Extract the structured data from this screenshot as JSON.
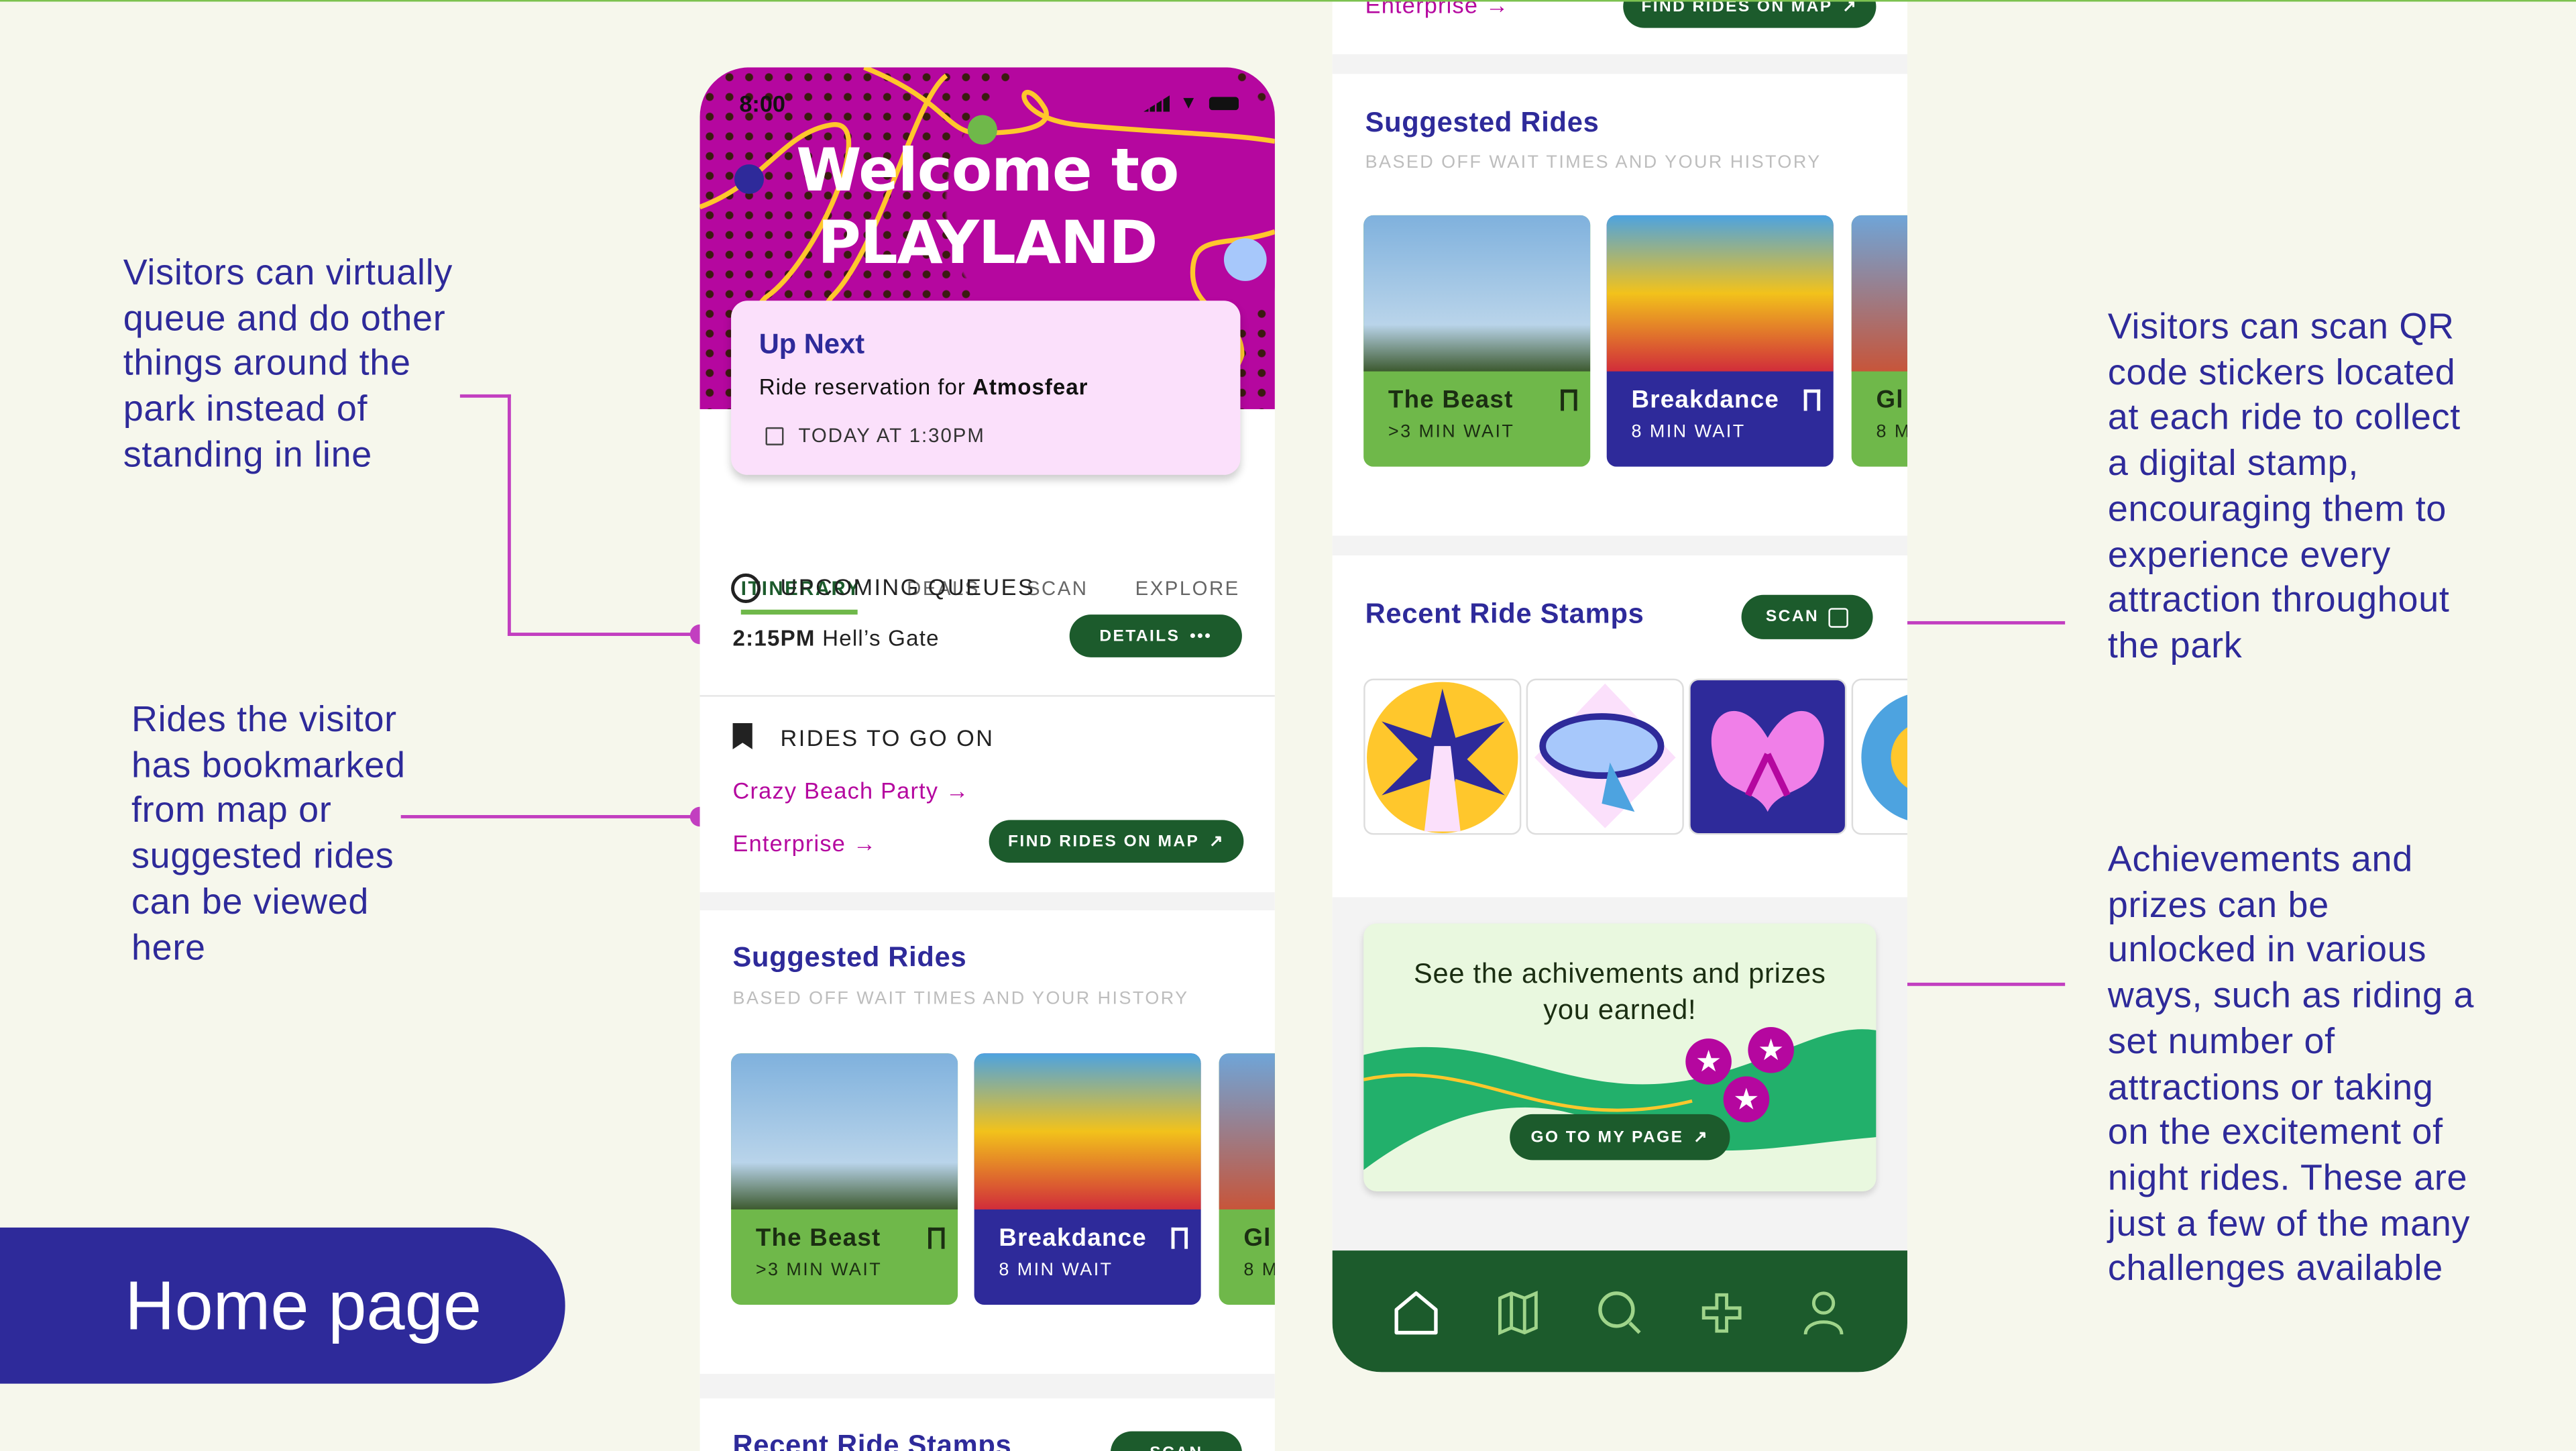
{
  "annotations": {
    "left_top": "Visitors can virtually queue and do other things around the park instead of standing in line",
    "left_bottom": "Rides the visitor has bookmarked from map or suggested rides can be viewed here",
    "right_top": "Visitors can scan QR code stickers located at each ride to collect a digital stamp, encouraging them to experience every attraction throughout the park",
    "right_bottom": "Achievements and prizes can be unlocked in various ways, such as riding a set number of attractions or taking on the excitement of night rides. These are just a few of the many challenges available"
  },
  "page_label": "Home page",
  "colors": {
    "indigo": "#2e2a9a",
    "magenta": "#b5079f",
    "dark_green": "#1c5b2c",
    "green": "#6fb84a",
    "pink": "#fbe0fb"
  },
  "phone1": {
    "status_time": "8:00",
    "hero_line1": "Welcome to",
    "hero_line2": "PLAYLAND",
    "up_next": {
      "title": "Up Next",
      "text": "Ride reservation for ",
      "ride": "Atmosfear",
      "time": "TODAY AT 1:30PM"
    },
    "tabs": [
      "ITINERARY",
      "DEALS",
      "SCAN",
      "EXPLORE"
    ],
    "queues": {
      "title": "UPCOMING QUEUES",
      "time": "2:15PM",
      "ride": "Hell’s Gate",
      "button": "DETAILS"
    },
    "rides_to_go": {
      "title": "RIDES TO GO ON",
      "items": [
        "Crazy Beach Party",
        "Enterprise"
      ],
      "button": "FIND RIDES ON MAP"
    },
    "suggested": {
      "title": "Suggested Rides",
      "subtitle": "BASED OFF WAIT TIMES AND YOUR HISTORY",
      "rides": [
        {
          "name": "The Beast",
          "wait": ">3 MIN WAIT"
        },
        {
          "name": "Breakdance",
          "wait": "8 MIN WAIT"
        },
        {
          "name": "Gl",
          "wait": "8 M"
        }
      ]
    },
    "stamps_title": "Recent Ride Stamps",
    "scan_button": "SCAN"
  },
  "phone2": {
    "enterprise": "Enterprise",
    "find_button": "FIND RIDES ON MAP",
    "suggested": {
      "title": "Suggested Rides",
      "subtitle": "BASED OFF WAIT TIMES AND YOUR HISTORY",
      "rides": [
        {
          "name": "The Beast",
          "wait": ">3 MIN WAIT"
        },
        {
          "name": "Breakdance",
          "wait": "8 MIN WAIT"
        },
        {
          "name": "Gl",
          "wait": "8 M"
        }
      ]
    },
    "stamps": {
      "title": "Recent Ride Stamps",
      "button": "SCAN"
    },
    "achievements": {
      "text": "See the achivements and prizes you earned!",
      "button": "GO TO MY PAGE"
    },
    "nav": [
      "home-icon",
      "map-icon",
      "search-icon",
      "gamepad-icon",
      "profile-icon"
    ]
  }
}
